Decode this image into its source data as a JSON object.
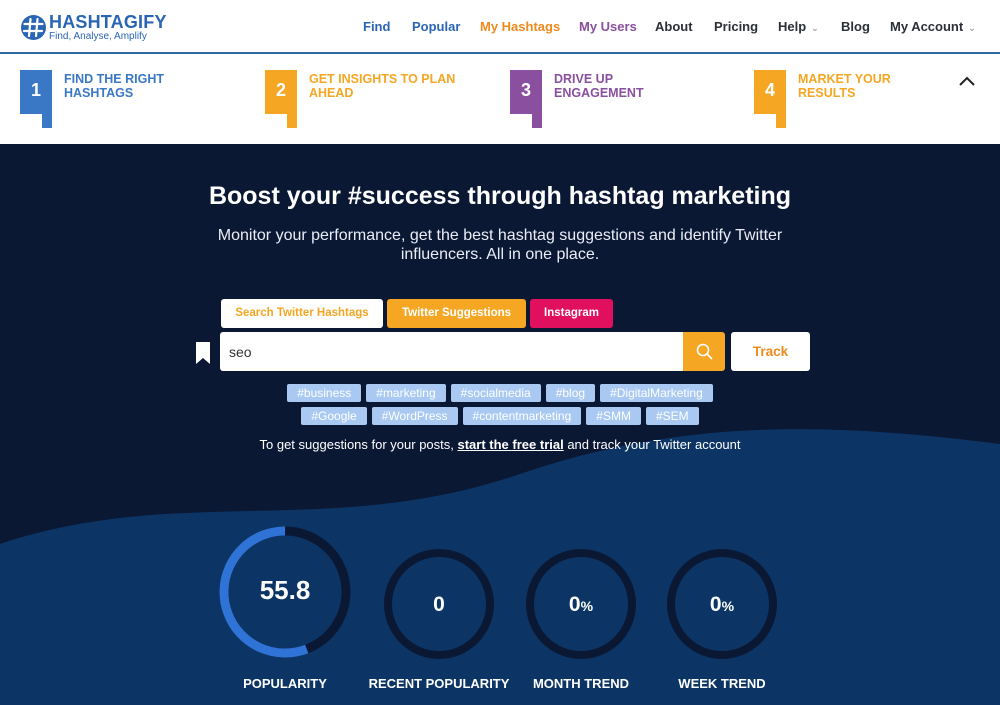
{
  "brand": {
    "name": "HASHTAGIFY",
    "tagline": "Find, Analyse, Amplify"
  },
  "nav": {
    "items": [
      {
        "label": "Find",
        "color": "#2a65b4"
      },
      {
        "label": "Popular",
        "color": "#2a65b4"
      },
      {
        "label": "My Hashtags",
        "color": "#f08a1c"
      },
      {
        "label": "My Users",
        "color": "#8a4f9e"
      },
      {
        "label": "About",
        "color": "#2b2f36"
      },
      {
        "label": "Pricing",
        "color": "#2b2f36"
      },
      {
        "label": "Help",
        "color": "#2b2f36"
      },
      {
        "label": "Blog",
        "color": "#2b2f36"
      },
      {
        "label": "My Account",
        "color": "#2b2f36"
      }
    ]
  },
  "steps": [
    {
      "number": "1",
      "text": "FIND THE RIGHT HASHTAGS",
      "color": "#3a78c5"
    },
    {
      "number": "2",
      "text": "GET INSIGHTS TO PLAN AHEAD",
      "color": "#f5a623"
    },
    {
      "number": "3",
      "text": "DRIVE UP ENGAGEMENT",
      "color": "#8a4f9e"
    },
    {
      "number": "4",
      "text": "MARKET YOUR RESULTS",
      "color": "#f5a623"
    }
  ],
  "hero": {
    "title": "Boost your #success through hashtag marketing",
    "subtitle": "Monitor your performance, get the best hashtag suggestions and identify Twitter influencers. All in one place."
  },
  "tabs": {
    "search": "Search Twitter Hashtags",
    "suggestions": "Twitter Suggestions",
    "instagram": "Instagram"
  },
  "search": {
    "value": "seo",
    "track_label": "Track"
  },
  "chips_row1": [
    "#business",
    "#marketing",
    "#socialmedia",
    "#blog",
    "#DigitalMarketing"
  ],
  "chips_row2": [
    "#Google",
    "#WordPress",
    "#contentmarketing",
    "#SMM",
    "#SEM"
  ],
  "trial": {
    "before": "To get suggestions for your posts, ",
    "link": "start the free trial",
    "after": " and track your Twitter account"
  },
  "metrics": {
    "popularity": {
      "value": "55.8",
      "label": "POPULARITY",
      "fraction": 0.558
    },
    "recent_popularity": {
      "value": "0",
      "label": "RECENT POPULARITY"
    },
    "month_trend": {
      "value": "0",
      "unit": "%",
      "label": "MONTH TREND"
    },
    "week_trend": {
      "value": "0",
      "unit": "%",
      "label": "WEEK TREND"
    }
  },
  "colors": {
    "hero_dark": "#0b1834",
    "hero_wave": "#0c3566",
    "accent_orange": "#f5a623",
    "instagram_pink": "#e0105f",
    "chip_blue": "#a9c9f3",
    "progress_blue": "#2f73d6",
    "ring_track": "#0b1834"
  }
}
